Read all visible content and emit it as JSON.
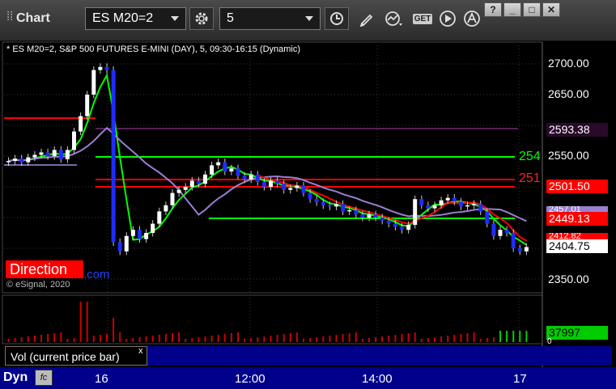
{
  "toolbar": {
    "title": "Chart",
    "symbol": "ES M20=2",
    "interval": "5",
    "get_label": "GET",
    "window_buttons": [
      "?",
      "_",
      "□",
      "✕"
    ]
  },
  "chart": {
    "header": "* ES M20=2, S&P 500 FUTURES E-MINI (DAY), 5, 09:30-16:15 (Dynamic)",
    "price_ticks": [
      "2700.00",
      "2650.00",
      "2550.00",
      "2350.00"
    ],
    "price_boxes": [
      {
        "text": "2593.38",
        "bg": "#2a0a2a",
        "fg": "#ffffff"
      },
      {
        "text": "2501.50",
        "bg": "#ff0000",
        "fg": "#ffffff"
      },
      {
        "text": "2449.13",
        "bg": "#ff0000",
        "fg": "#ffffff"
      },
      {
        "text": "2404.75",
        "bg": "#ffffff",
        "fg": "#000000"
      }
    ],
    "partial_box_a": "2457.01",
    "partial_box_b": "2412.82",
    "level_labels": [
      {
        "text": "254",
        "color": "#00ff00"
      },
      {
        "text": "251",
        "color": "#ff2020"
      }
    ],
    "direction_label": "Direction",
    "com_fragment": ".com",
    "copyright": "© eSignal, 2020",
    "time_labels": [
      "16",
      "12:00",
      "14:00",
      "17"
    ]
  },
  "volume": {
    "label": "Vol (current price bar)",
    "close": "x",
    "value": "37997",
    "tick": "0"
  },
  "footer": {
    "dyn": "Dyn",
    "fx": "fc"
  },
  "colors": {
    "up_candle": "#ffffff",
    "down_candle": "#1e2dff",
    "green_line": "#00ff00",
    "red_line": "#ff0000",
    "purple_line": "#9b7fd0",
    "volume_bar": "#cc0000"
  }
}
